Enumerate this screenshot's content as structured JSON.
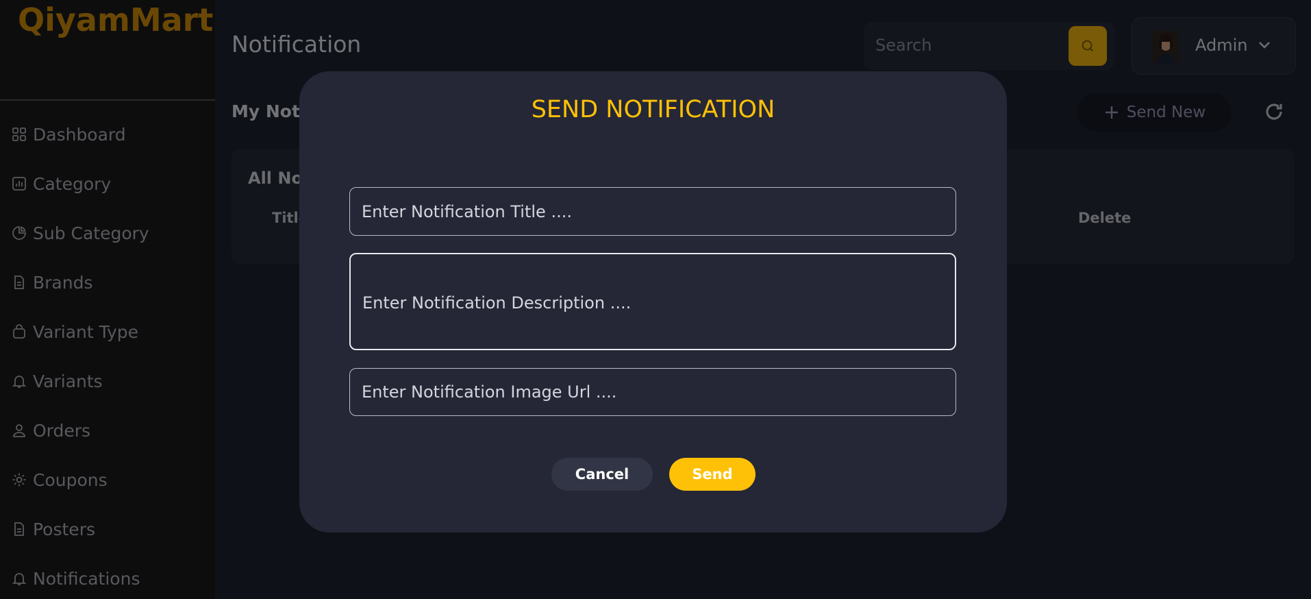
{
  "brand": {
    "logo": "QiyamMart",
    "accent": "#ffc107",
    "logo_color": "#d59008"
  },
  "sidebar": {
    "items": [
      {
        "label": "Dashboard",
        "icon": "dashboard-icon"
      },
      {
        "label": "Category",
        "icon": "chart-icon"
      },
      {
        "label": "Sub Category",
        "icon": "pie-chart-icon"
      },
      {
        "label": "Brands",
        "icon": "document-icon"
      },
      {
        "label": "Variant Type",
        "icon": "bag-icon"
      },
      {
        "label": "Variants",
        "icon": "bell-icon"
      },
      {
        "label": "Orders",
        "icon": "user-icon"
      },
      {
        "label": "Coupons",
        "icon": "gear-icon"
      },
      {
        "label": "Posters",
        "icon": "document-icon"
      },
      {
        "label": "Notifications",
        "icon": "bell-icon"
      }
    ]
  },
  "header": {
    "title": "Notification",
    "search_placeholder": "Search",
    "user_name": "Admin"
  },
  "main": {
    "section_title": "My Notif",
    "send_new_label": "Send New",
    "card_title": "All Not",
    "columns": {
      "title": "Title",
      "delete": "Delete"
    }
  },
  "modal": {
    "title": "SEND NOTIFICATION",
    "title_placeholder": "Enter Notification Title ....",
    "description_placeholder": "Enter Notification Description ....",
    "image_placeholder": "Enter Notification Image Url ....",
    "cancel_label": "Cancel",
    "send_label": "Send"
  }
}
